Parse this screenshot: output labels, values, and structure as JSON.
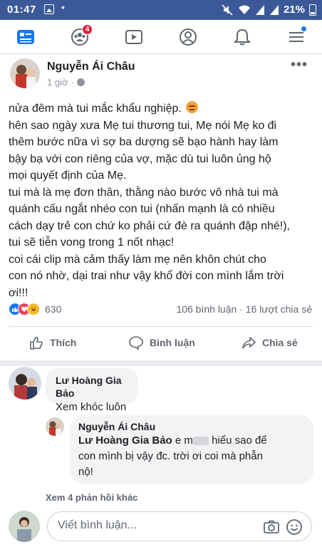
{
  "status_bar": {
    "time": "01:47",
    "battery": "21%"
  },
  "nav": {
    "friends_badge": "4"
  },
  "post": {
    "author": "Nguyễn Ái Châu",
    "time": "1 giờ",
    "text_lines": [
      "nửa đêm mà tui mắc khẩu nghiệp. ",
      "hên sao ngày xưa Mẹ tui thương tui, Mẹ nói Mẹ ko đi",
      "thêm bước nữa vì sợ ba dượng sẽ bạo hành hay làm",
      "bậy bạ với con riêng của vợ, mặc dù tui luôn ủng hộ",
      "mọi quyết định của Mẹ.",
      "tui mà là mẹ đơn thân, thằng nào bước vô nhà tui mà",
      "quánh cấu ngắt nhéo con tui (nhấn mạnh là có nhiều",
      "cách dạy trẻ con chứ ko phải cứ đè ra quánh đập nhé!),",
      "tui sẽ tiễn vong trong 1 nốt nhạc!",
      "coi cái clip mà cảm thấy làm mẹ nên khôn chút cho",
      "con nó nhờ, dại trai như vậy khổ đời con mình lắm trời",
      "ơi!!!"
    ],
    "reaction_count": "630",
    "comment_stats": "106 bình luận · 16 lượt chia sẻ"
  },
  "actions": {
    "like": "Thích",
    "comment": "Bình luận",
    "share": "Chia sẻ"
  },
  "comments": [
    {
      "name": "Lư Hoàng Gia Bảo",
      "text": "Xem khóc luôn"
    }
  ],
  "reply": {
    "name": "Nguyễn Ái Châu",
    "mention": "Lư Hoàng Gia Bảo",
    "text_after_mention": " e m",
    "text_after_redact": " hiểu sao để",
    "line2": "con mình bị vậy đc. trời ơi coi mà phẫn",
    "line3": "nộ!"
  },
  "more_replies": "Xem 4 phản hồi khác",
  "write_comment": {
    "placeholder": "Viết bình luận..."
  }
}
